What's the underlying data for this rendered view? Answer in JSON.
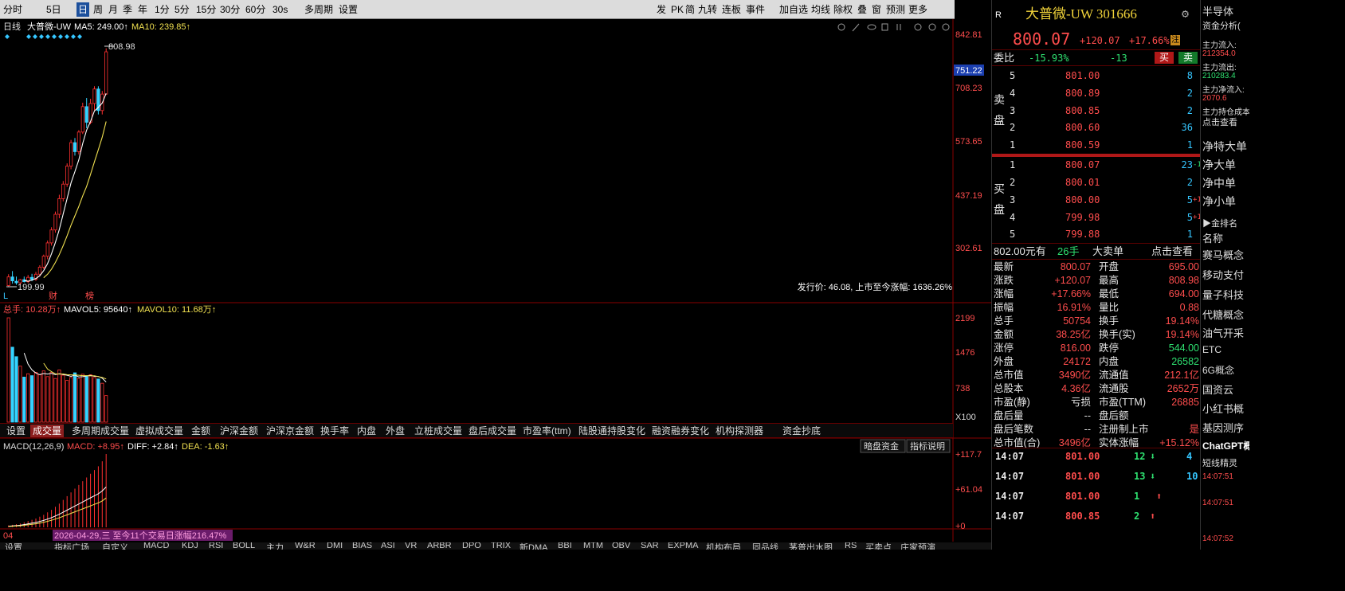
{
  "toolbar": {
    "items": [
      "分时",
      "5日",
      "日",
      "周",
      "月",
      "季",
      "年",
      "1分",
      "5分",
      "15分",
      "30分",
      "60分",
      "30s",
      "多周期",
      "设置"
    ],
    "right_items": [
      "发",
      "PK",
      "简",
      "九转",
      "连板",
      "事件",
      "加自选",
      "均线",
      "除权",
      "叠",
      "窗",
      "预测",
      "更多"
    ]
  },
  "chart": {
    "period_label": "日线",
    "stock_name": "大普微-UW",
    "ma5": "MA5: 249.00↑",
    "ma10": "MA10: 239.85↑",
    "price_labels": [
      "842.81",
      "708.23",
      "573.65",
      "437.19",
      "302.61"
    ],
    "current_price_box": "751.22",
    "high_mark": "808.98",
    "low_mark": "199.99",
    "markers": [
      "L",
      "财",
      "榜"
    ],
    "ipo_note": "发行价: 46.08, 上市至今涨幅: 1636.26%",
    "vol_header": {
      "total": "总手: 10.28万↑",
      "mavol5": "MAVOL5: 95640↑",
      "mavol10": "MAVOL10: 11.68万↑"
    },
    "vol_labels": [
      "2199",
      "1476",
      "738",
      "X100"
    ],
    "macd_header": {
      "name": "MACD(12,26,9)",
      "macd": "MACD: +8.95↑",
      "diff": "DIFF: +2.84↑",
      "dea": "DEA: -1.63↑"
    },
    "macd_labels": [
      "+117.7",
      "+61.04",
      "+0"
    ],
    "macd_buttons": [
      "暗盘资金",
      "指标说明"
    ],
    "range_note": "2026-04-29,三 至今11个交易日涨幅216.47%",
    "left_footer": "04"
  },
  "chart_data": [
    {
      "type": "candlestick",
      "name": "",
      "series": [
        {
          "o": 203,
          "h": 232,
          "l": 199.99,
          "c": 225
        },
        {
          "o": 225,
          "h": 240,
          "l": 208,
          "c": 215
        },
        {
          "o": 214,
          "h": 226,
          "l": 205,
          "c": 210
        },
        {
          "o": 210,
          "h": 220,
          "l": 204,
          "c": 218
        },
        {
          "o": 218,
          "h": 226,
          "l": 211,
          "c": 213
        },
        {
          "o": 213,
          "h": 230,
          "l": 209,
          "c": 224
        },
        {
          "o": 224,
          "h": 233,
          "l": 214,
          "c": 219
        },
        {
          "o": 219,
          "h": 238,
          "l": 215,
          "c": 232
        },
        {
          "o": 232,
          "h": 255,
          "l": 226,
          "c": 250
        },
        {
          "o": 250,
          "h": 282,
          "l": 245,
          "c": 278
        },
        {
          "o": 278,
          "h": 318,
          "l": 270,
          "c": 312
        },
        {
          "o": 312,
          "h": 352,
          "l": 305,
          "c": 345
        },
        {
          "o": 345,
          "h": 392,
          "l": 338,
          "c": 385
        },
        {
          "o": 385,
          "h": 435,
          "l": 375,
          "c": 425
        },
        {
          "o": 425,
          "h": 470,
          "l": 418,
          "c": 462
        },
        {
          "o": 462,
          "h": 515,
          "l": 455,
          "c": 508
        },
        {
          "o": 508,
          "h": 575,
          "l": 500,
          "c": 568
        },
        {
          "o": 568,
          "h": 580,
          "l": 535,
          "c": 545
        },
        {
          "o": 545,
          "h": 600,
          "l": 538,
          "c": 595
        },
        {
          "o": 595,
          "h": 670,
          "l": 590,
          "c": 660
        },
        {
          "o": 660,
          "h": 682,
          "l": 605,
          "c": 620
        },
        {
          "o": 620,
          "h": 680,
          "l": 615,
          "c": 668
        },
        {
          "o": 668,
          "h": 712,
          "l": 650,
          "c": 705
        },
        {
          "o": 705,
          "h": 712,
          "l": 640,
          "c": 650
        },
        {
          "o": 650,
          "h": 700,
          "l": 640,
          "c": 692
        },
        {
          "o": 692,
          "h": 808.98,
          "l": 690,
          "c": 800
        }
      ],
      "ma5": [
        null,
        null,
        null,
        null,
        216,
        214,
        217,
        221,
        228,
        241,
        259,
        284,
        313,
        346,
        386,
        425,
        465,
        494,
        524,
        566,
        600,
        622,
        649,
        658,
        669,
        694
      ],
      "ma10": [
        null,
        null,
        null,
        null,
        null,
        null,
        null,
        null,
        null,
        223,
        232,
        245,
        262,
        282,
        305,
        330,
        357,
        381,
        405,
        432,
        456,
        487,
        519,
        550,
        582,
        622
      ]
    },
    {
      "type": "bar",
      "name": "",
      "values": [
        2199,
        1580,
        1380,
        1180,
        950,
        1020,
        980,
        1050,
        1000,
        1080,
        960,
        1050,
        920,
        1100,
        990,
        880,
        940,
        1040,
        920,
        1010,
        960,
        1000,
        940,
        910,
        820,
        560
      ]
    },
    {
      "type": "bar",
      "name": "MACD",
      "values": [
        3,
        4,
        5,
        6,
        8,
        10,
        12,
        14,
        17,
        20,
        24,
        28,
        33,
        38,
        44,
        50,
        56,
        62,
        68,
        74,
        80,
        86,
        92,
        98,
        106,
        117.7
      ]
    }
  ],
  "quote": {
    "name_code": "大普微-UW 301666",
    "price": "800.07",
    "change": "+120.07",
    "pct": "+17.66%",
    "webi_label": "委比",
    "webi": "-15.93%",
    "wecha": "-13",
    "buy_btn": "买",
    "sell_btn": "卖",
    "sell_label": "卖盘",
    "buy_label": "买盘",
    "asks": [
      [
        "5",
        "801.00",
        "8"
      ],
      [
        "4",
        "800.89",
        "2"
      ],
      [
        "3",
        "800.85",
        "2"
      ],
      [
        "2",
        "800.60",
        "36"
      ],
      [
        "1",
        "800.59",
        "1"
      ]
    ],
    "bids": [
      [
        "1",
        "800.07",
        "23",
        "-1"
      ],
      [
        "2",
        "800.01",
        "2",
        ""
      ],
      [
        "3",
        "800.00",
        "5",
        "+1"
      ],
      [
        "4",
        "799.98",
        "5",
        "+1"
      ],
      [
        "5",
        "799.88",
        "1",
        ""
      ]
    ],
    "big_order": {
      "amount": "802.00元有",
      "hand": "26手",
      "label": "大卖单",
      "link": "点击查看"
    },
    "stats": [
      [
        "最新",
        "800.07",
        "开盘",
        "695.00"
      ],
      [
        "涨跌",
        "+120.07",
        "最高",
        "808.98"
      ],
      [
        "涨幅",
        "+17.66%",
        "最低",
        "694.00"
      ],
      [
        "振幅",
        "16.91%",
        "量比",
        "0.88"
      ],
      [
        "总手",
        "50754",
        "换手",
        "19.14%"
      ],
      [
        "金额",
        "38.25亿",
        "换手(实)",
        "19.14%"
      ],
      [
        "涨停",
        "816.00",
        "跌停",
        "544.00"
      ],
      [
        "外盘",
        "24172",
        "内盘",
        "26582"
      ],
      [
        "总市值",
        "3490亿",
        "流通值",
        "212.1亿"
      ],
      [
        "总股本",
        "4.36亿",
        "流通股",
        "2652万"
      ],
      [
        "市盈(静)",
        "亏损",
        "市盈(TTM)",
        "26885"
      ],
      [
        "盘后量",
        "--",
        "盘后额",
        ""
      ],
      [
        "盘后笔数",
        "--",
        "注册制上市",
        "是"
      ],
      [
        "总市值(合)",
        "3496亿",
        "实体涨幅",
        "+15.12%"
      ]
    ],
    "ticks": [
      [
        "14:07",
        "801.00",
        "12",
        "4"
      ],
      [
        "14:07",
        "801.00",
        "13",
        "10"
      ],
      [
        "14:07",
        "801.00",
        "1",
        ""
      ],
      [
        "14:07",
        "800.85",
        "2",
        ""
      ]
    ]
  },
  "far": {
    "title": "半导体",
    "sub": "资金分析(",
    "flows": [
      [
        "主力流入:",
        "212354.0"
      ],
      [
        "主力流出:",
        "210283.4"
      ],
      [
        "主力净流入:",
        "2070.6"
      ],
      [
        "主力持仓成本",
        ""
      ]
    ],
    "link": "点击查看",
    "net": [
      "净特大单",
      "净大单",
      "净中单",
      "净小单"
    ],
    "rank_header": "金排名",
    "rank_sub": "名称",
    "concepts": [
      "赛马概念",
      "移动支付",
      "量子科技",
      "代糖概念",
      "油气开采",
      "ETC",
      "6G概念",
      "国资云",
      "小红书概",
      "基因测序",
      "ChatGPT概"
    ],
    "short_title": "短线精灵",
    "times": [
      "14:07:51",
      "14:07:51",
      "14:07:52"
    ]
  },
  "tabs": {
    "middle": [
      "设置",
      "成交量",
      "多周期成交量",
      "虚拟成交量",
      "金额",
      "沪深金额",
      "沪深京金额",
      "换手率",
      "内盘",
      "外盘",
      "立桩成交量",
      "盘后成交量",
      "市盈率(ttm)",
      "陆股通持股变化",
      "融资融券变化",
      "机构探测器",
      "资金抄底"
    ],
    "bottom": [
      "设置",
      "指标广场",
      "自定义",
      "MACD",
      "KDJ",
      "RSI",
      "BOLL",
      "主力",
      "W&R",
      "DMI",
      "BIAS",
      "ASI",
      "VR",
      "ARBR",
      "DPO",
      "TRIX",
      "新DMA",
      "BBI",
      "MTM",
      "OBV",
      "SAR",
      "EXPMA",
      "机构布局",
      "同品线",
      "茅普出水图",
      "RS",
      "买卖点",
      "庄家预演"
    ]
  },
  "colors": {
    "up": "#ff3030",
    "down": "#35d3ff",
    "ma5": "#ffffff",
    "ma10": "#f0e050",
    "grid": "#5a0000",
    "bg": "#000000"
  }
}
